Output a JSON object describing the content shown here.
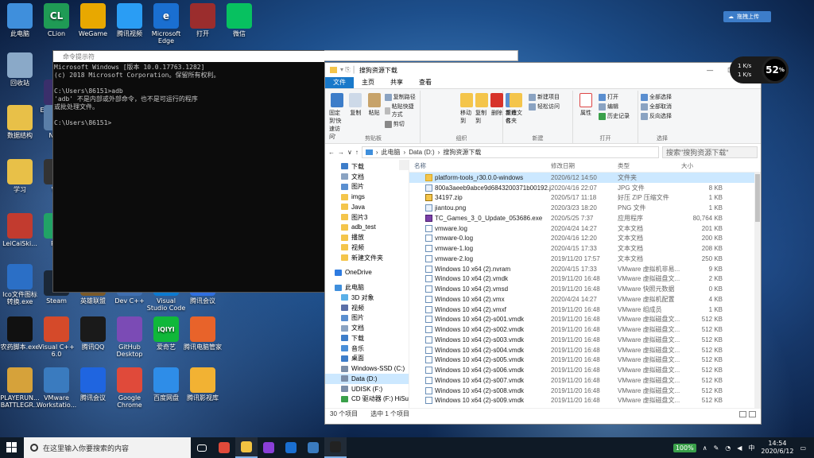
{
  "desktop": {
    "icons": [
      {
        "label": "此电脑",
        "color": "#3f8fdc",
        "glyph": ""
      },
      {
        "label": "CLion",
        "color": "#1f9b55",
        "glyph": "CL"
      },
      {
        "label": "WeGame",
        "color": "#e8a800",
        "glyph": ""
      },
      {
        "label": "腾讯视频",
        "color": "#2a9df4",
        "glyph": ""
      },
      {
        "label": "Microsoft Edge",
        "color": "#1a6fd1",
        "glyph": "e"
      },
      {
        "label": "打开",
        "color": "#9b2d2d",
        "glyph": ""
      },
      {
        "label": "微信",
        "color": "#07c160",
        "glyph": ""
      },
      {
        "label": "回收站",
        "color": "#8aa9c8",
        "glyph": ""
      },
      {
        "label": "Eclip Laun",
        "color": "#3a2f6b",
        "glyph": ""
      },
      {
        "label": "数据结构",
        "color": "#e8c048",
        "glyph": ""
      },
      {
        "label": "Note",
        "color": "#5a7ea8",
        "glyph": ""
      },
      {
        "label": "学习",
        "color": "#e8c048",
        "glyph": ""
      },
      {
        "label": "Wo",
        "color": "#333333",
        "glyph": ""
      },
      {
        "label": "LeiCaiSki...",
        "color": "#c23b2f",
        "glyph": ""
      },
      {
        "label": "Pyc",
        "color": "#21a366",
        "glyph": ""
      },
      {
        "label": "Ico文件图标转换.exe",
        "color": "#2b6fc6",
        "glyph": ""
      },
      {
        "label": "Steam",
        "color": "#1b2838",
        "glyph": ""
      },
      {
        "label": "英雄联盟",
        "color": "#7a5a2a",
        "glyph": ""
      },
      {
        "label": "Dev C++",
        "color": "#3f6fb0",
        "glyph": ""
      },
      {
        "label": "Visual Studio Code",
        "color": "#0b7ad1",
        "glyph": ""
      },
      {
        "label": "腾讯会议",
        "color": "#2f6fe0",
        "glyph": ""
      },
      {
        "label": "农药脚本.exe",
        "color": "#111111",
        "glyph": ""
      },
      {
        "label": "Visual C++ 6.0",
        "color": "#d54a2a",
        "glyph": ""
      },
      {
        "label": "腾讯QQ",
        "color": "#1a1a1a",
        "glyph": ""
      },
      {
        "label": "GitHub Desktop",
        "color": "#7b4bb5",
        "glyph": ""
      },
      {
        "label": "爱奇艺",
        "color": "#10b83a",
        "glyph": "iQIYI"
      },
      {
        "label": "腾讯电脑管家",
        "color": "#e8632a",
        "glyph": ""
      },
      {
        "label": "PLAYERUN... BATTLEGR...",
        "color": "#d6a23a",
        "glyph": ""
      },
      {
        "label": "VMware Workstatio...",
        "color": "#3a7bbf",
        "glyph": ""
      },
      {
        "label": "腾讯会议",
        "color": "#1f65e0",
        "glyph": ""
      },
      {
        "label": "Google Chrome",
        "color": "#e04a3a",
        "glyph": ""
      },
      {
        "label": "百度网盘",
        "color": "#2e8de8",
        "glyph": ""
      },
      {
        "label": "腾讯影视库",
        "color": "#f2b233",
        "glyph": ""
      }
    ]
  },
  "cmd": {
    "title": "命令提示符",
    "lines": "Microsoft Windows [版本 10.0.17763.1282]\n(c) 2018 Microsoft Corporation。保留所有权利。\n\nC:\\Users\\86151>adb\n'adb' 不是内部或外部命令，也不是可运行的程序\n或批处理文件。\n\nC:\\Users\\86151>"
  },
  "explorer": {
    "title": "搜狗资源下载",
    "tabs": [
      "文件",
      "主页",
      "共享",
      "查看"
    ],
    "ribbon": {
      "clipboard": {
        "pin": "固定到'快速访问'",
        "copy": "复制",
        "paste": "粘贴",
        "cut": "剪切",
        "copy_path": "复制路径",
        "paste_shortcut": "粘贴快捷方式",
        "name": "剪贴板"
      },
      "organize": {
        "move": "移动到",
        "copyto": "复制到",
        "delete": "删除",
        "rename": "重命名",
        "name": "组织"
      },
      "new": {
        "folder": "新建文件夹",
        "item": "新建项目",
        "easy": "轻松访问",
        "name": "新建"
      },
      "open": {
        "props": "属性",
        "open": "打开",
        "edit": "编辑",
        "history": "历史记录",
        "name": "打开"
      },
      "select": {
        "all": "全部选择",
        "none": "全部取消",
        "invert": "反向选择",
        "name": "选择"
      }
    },
    "address": {
      "pc": "此电脑",
      "drive": "Data (D:)",
      "folder": "搜狗资源下载",
      "search_placeholder": "搜索\"搜狗资源下载\""
    },
    "nav": [
      {
        "label": "下载",
        "kind": "sub",
        "color": "#3d7dc9"
      },
      {
        "label": "文档",
        "kind": "sub",
        "color": "#8aa3c2"
      },
      {
        "label": "图片",
        "kind": "sub",
        "color": "#5b8fd0"
      },
      {
        "label": "imgs",
        "kind": "sub",
        "color": "#f4c54b"
      },
      {
        "label": "Java",
        "kind": "sub",
        "color": "#f4c54b"
      },
      {
        "label": "图片3",
        "kind": "sub",
        "color": "#f4c54b"
      },
      {
        "label": "adb_test",
        "kind": "sub",
        "color": "#f4c54b"
      },
      {
        "label": "播放",
        "kind": "sub",
        "color": "#f4c54b"
      },
      {
        "label": "视频",
        "kind": "sub",
        "color": "#f4c54b"
      },
      {
        "label": "新建文件夹",
        "kind": "sub",
        "color": "#f4c54b"
      },
      {
        "label": "",
        "kind": "gap",
        "color": ""
      },
      {
        "label": "OneDrive",
        "kind": "top",
        "color": "#2e7be0"
      },
      {
        "label": "",
        "kind": "gap",
        "color": ""
      },
      {
        "label": "此电脑",
        "kind": "top",
        "color": "#3f8fdc"
      },
      {
        "label": "3D 对象",
        "kind": "sub",
        "color": "#5ab0e8"
      },
      {
        "label": "视频",
        "kind": "sub",
        "color": "#5a6fa8"
      },
      {
        "label": "图片",
        "kind": "sub",
        "color": "#5b8fd0"
      },
      {
        "label": "文档",
        "kind": "sub",
        "color": "#8aa3c2"
      },
      {
        "label": "下载",
        "kind": "sub",
        "color": "#3d7dc9"
      },
      {
        "label": "音乐",
        "kind": "sub",
        "color": "#4a8fd8"
      },
      {
        "label": "桌面",
        "kind": "sub",
        "color": "#3d7dc9"
      },
      {
        "label": "Windows-SSD (C:)",
        "kind": "sub",
        "color": "#7b8ea8"
      },
      {
        "label": "Data (D:)",
        "kind": "sel",
        "color": "#7b8ea8"
      },
      {
        "label": "UDISK (F:)",
        "kind": "sub",
        "color": "#7b8ea8"
      },
      {
        "label": "CD 驱动器 (F:) HiSuite",
        "kind": "sub",
        "color": "#3aa04a"
      }
    ],
    "columns": {
      "name": "名称",
      "date": "修改日期",
      "type": "类型",
      "size": "大小"
    },
    "files": [
      {
        "name": "platform-tools_r30.0.0-windows",
        "date": "2020/6/12 14:50",
        "type": "文件夹",
        "size": "",
        "icon": "fold",
        "sel": true
      },
      {
        "name": "800a3aeeb9abce9d6843200371b00192.jpg",
        "date": "2020/4/16 22:07",
        "type": "JPG 文件",
        "size": "8 KB",
        "icon": "img",
        "sel": false
      },
      {
        "name": "34197.zip",
        "date": "2020/5/17 11:18",
        "type": "好压 ZIP 压缩文件",
        "size": "1 KB",
        "icon": "zip",
        "sel": false
      },
      {
        "name": "jiantou.png",
        "date": "2020/3/23 18:20",
        "type": "PNG 文件",
        "size": "1 KB",
        "icon": "img",
        "sel": false
      },
      {
        "name": "TC_Games_3_0_Update_053686.exe",
        "date": "2020/5/25 7:37",
        "type": "应用程序",
        "size": "80,764 KB",
        "icon": "exe",
        "sel": false
      },
      {
        "name": "vmware.log",
        "date": "2020/4/24 14:27",
        "type": "文本文档",
        "size": "201 KB",
        "icon": "doc",
        "sel": false
      },
      {
        "name": "vmware-0.log",
        "date": "2020/4/16 12:20",
        "type": "文本文档",
        "size": "200 KB",
        "icon": "doc",
        "sel": false
      },
      {
        "name": "vmware-1.log",
        "date": "2020/4/15 17:33",
        "type": "文本文档",
        "size": "208 KB",
        "icon": "doc",
        "sel": false
      },
      {
        "name": "vmware-2.log",
        "date": "2019/11/20 17:57",
        "type": "文本文档",
        "size": "250 KB",
        "icon": "doc",
        "sel": false
      },
      {
        "name": "Windows 10 x64 (2).nvram",
        "date": "2020/4/15 17:33",
        "type": "VMware 虚拟机非易...",
        "size": "9 KB",
        "icon": "doc",
        "sel": false
      },
      {
        "name": "Windows 10 x64 (2).vmdk",
        "date": "2019/11/20 16:48",
        "type": "VMware 虚拟磁盘文...",
        "size": "2 KB",
        "icon": "doc",
        "sel": false
      },
      {
        "name": "Windows 10 x64 (2).vmsd",
        "date": "2019/11/20 16:48",
        "type": "VMware 快照元数据",
        "size": "0 KB",
        "icon": "doc",
        "sel": false
      },
      {
        "name": "Windows 10 x64 (2).vmx",
        "date": "2020/4/24 14:27",
        "type": "VMware 虚拟机配置",
        "size": "4 KB",
        "icon": "doc",
        "sel": false
      },
      {
        "name": "Windows 10 x64 (2).vmxf",
        "date": "2019/11/20 16:48",
        "type": "VMware 组成员",
        "size": "1 KB",
        "icon": "doc",
        "sel": false
      },
      {
        "name": "Windows 10 x64 (2)-s001.vmdk",
        "date": "2019/11/20 16:48",
        "type": "VMware 虚拟磁盘文...",
        "size": "512 KB",
        "icon": "doc",
        "sel": false
      },
      {
        "name": "Windows 10 x64 (2)-s002.vmdk",
        "date": "2019/11/20 16:48",
        "type": "VMware 虚拟磁盘文...",
        "size": "512 KB",
        "icon": "doc",
        "sel": false
      },
      {
        "name": "Windows 10 x64 (2)-s003.vmdk",
        "date": "2019/11/20 16:48",
        "type": "VMware 虚拟磁盘文...",
        "size": "512 KB",
        "icon": "doc",
        "sel": false
      },
      {
        "name": "Windows 10 x64 (2)-s004.vmdk",
        "date": "2019/11/20 16:48",
        "type": "VMware 虚拟磁盘文...",
        "size": "512 KB",
        "icon": "doc",
        "sel": false
      },
      {
        "name": "Windows 10 x64 (2)-s005.vmdk",
        "date": "2019/11/20 16:48",
        "type": "VMware 虚拟磁盘文...",
        "size": "512 KB",
        "icon": "doc",
        "sel": false
      },
      {
        "name": "Windows 10 x64 (2)-s006.vmdk",
        "date": "2019/11/20 16:48",
        "type": "VMware 虚拟磁盘文...",
        "size": "512 KB",
        "icon": "doc",
        "sel": false
      },
      {
        "name": "Windows 10 x64 (2)-s007.vmdk",
        "date": "2019/11/20 16:48",
        "type": "VMware 虚拟磁盘文...",
        "size": "512 KB",
        "icon": "doc",
        "sel": false
      },
      {
        "name": "Windows 10 x64 (2)-s008.vmdk",
        "date": "2019/11/20 16:48",
        "type": "VMware 虚拟磁盘文...",
        "size": "512 KB",
        "icon": "doc",
        "sel": false
      },
      {
        "name": "Windows 10 x64 (2)-s009.vmdk",
        "date": "2019/11/20 16:48",
        "type": "VMware 虚拟磁盘文...",
        "size": "512 KB",
        "icon": "doc",
        "sel": false
      }
    ],
    "status": {
      "count": "30 个项目",
      "selected": "选中 1 个项目"
    }
  },
  "widget": {
    "up": "1 K/s",
    "down": "1 K/s",
    "percent": "52",
    "percent_sign": "%"
  },
  "cloud": {
    "label": "拖拽上传"
  },
  "taskbar": {
    "search_placeholder": "在这里输入你要搜索的内容",
    "apps": [
      {
        "name": "chrome-icon",
        "color": "#e04a3a",
        "active": false
      },
      {
        "name": "file-explorer-icon",
        "color": "#f2c341",
        "active": true
      },
      {
        "name": "purple-app-icon",
        "color": "#8a3fd8",
        "active": false
      },
      {
        "name": "edge-icon",
        "color": "#1a6fd1",
        "active": false
      },
      {
        "name": "vmware-icon",
        "color": "#3a7bbf",
        "active": false
      },
      {
        "name": "cmd-icon",
        "color": "#222222",
        "active": true
      }
    ],
    "battery": "100%",
    "ime": "中",
    "time": "14:54",
    "date": "2020/6/12"
  }
}
